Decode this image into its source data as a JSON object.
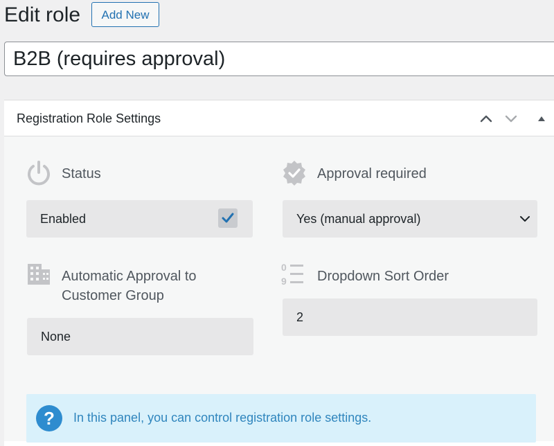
{
  "header": {
    "title": "Edit role",
    "add_new_label": "Add New"
  },
  "role_title": {
    "value": "B2B (requires approval)"
  },
  "panel": {
    "title": "Registration Role Settings",
    "controls": [
      "chevron-up-icon",
      "chevron-down-icon",
      "triangle-up-icon"
    ]
  },
  "fields": {
    "status": {
      "label": "Status",
      "icon": "power-icon",
      "value": "Enabled",
      "checked": true
    },
    "approval": {
      "label": "Approval required",
      "icon": "badge-check-icon",
      "value": "Yes (manual approval)"
    },
    "auto_approval": {
      "label_line1": "Automatic Approval to",
      "label_line2": "Customer Group",
      "icon": "building-icon",
      "value": "None"
    },
    "sort_order": {
      "label": "Dropdown Sort Order",
      "icon": "sort-numeric-icon",
      "value": "2"
    }
  },
  "info": {
    "icon": "question-icon",
    "text": "In this panel, you can control registration role settings."
  },
  "colors": {
    "accent": "#2271b1",
    "info_bg": "#d9f1fb",
    "info_text": "#2f85bd",
    "field_bg": "#e7e7e8",
    "checkbox_check": "#2271b1"
  }
}
